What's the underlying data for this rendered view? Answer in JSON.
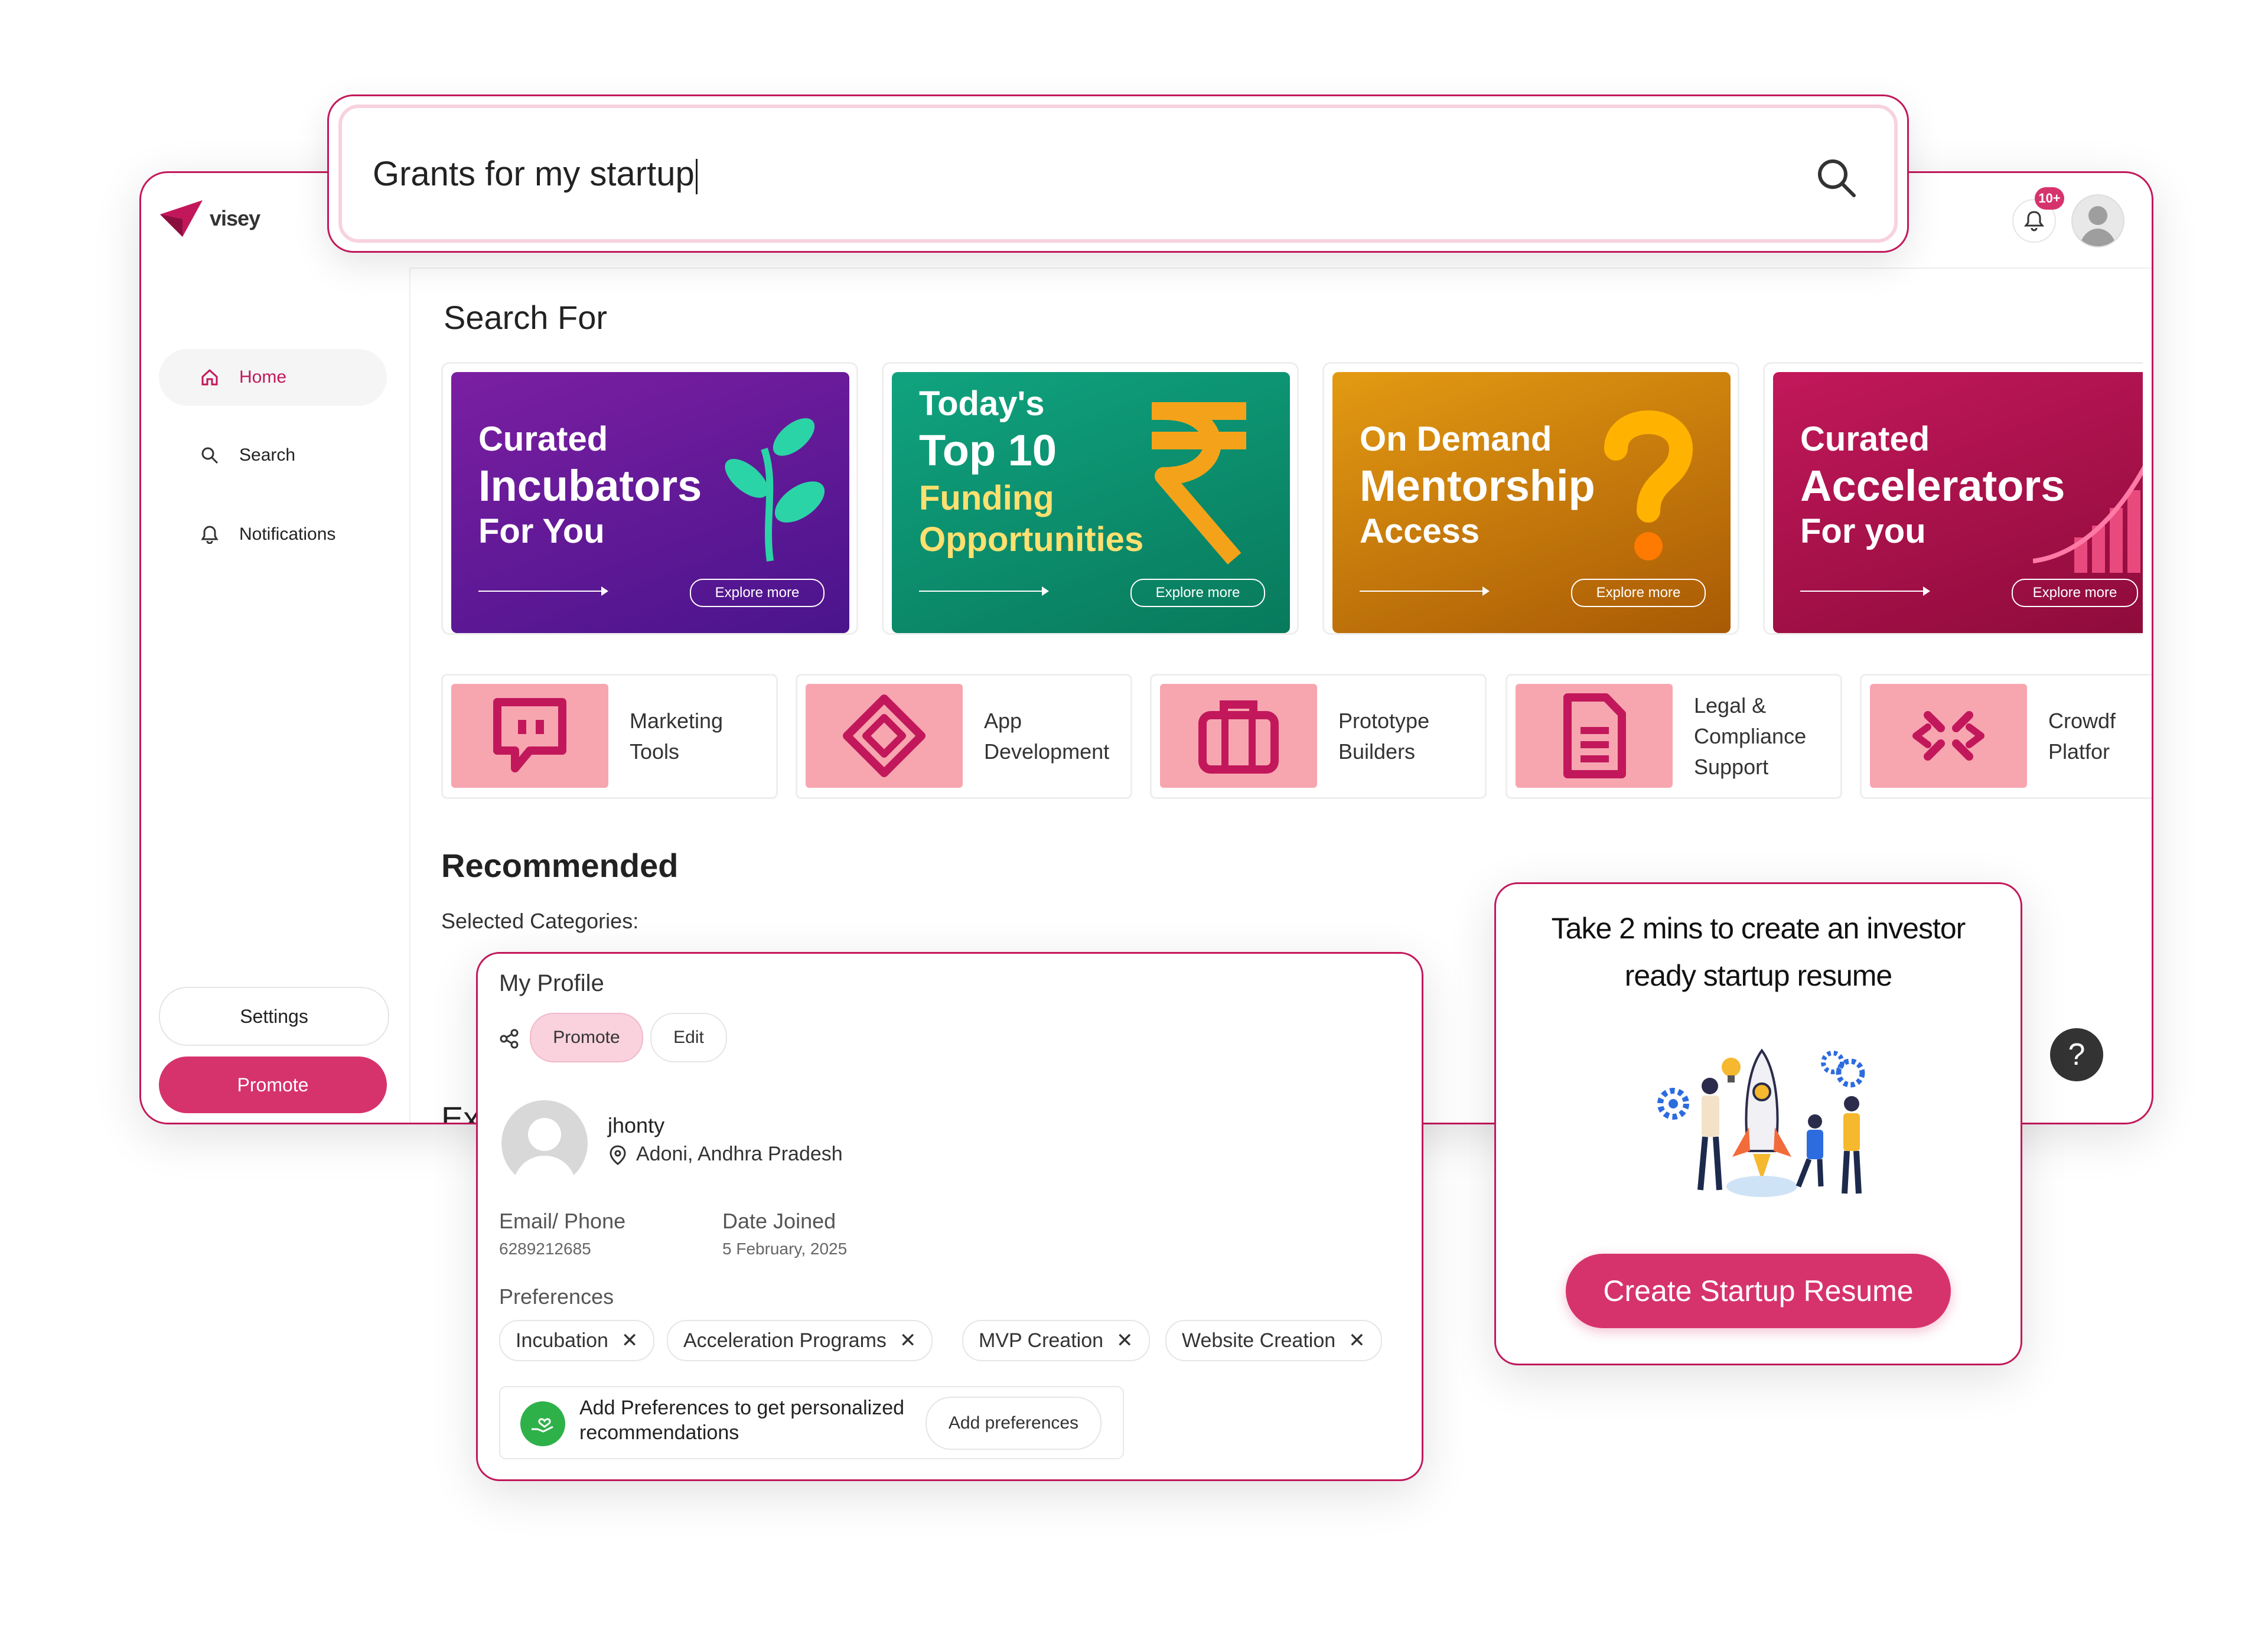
{
  "brand": {
    "name": "visey"
  },
  "search": {
    "value": "Grants for my startup"
  },
  "header": {
    "notification_badge": "10+"
  },
  "sidebar": {
    "items": [
      {
        "label": "Home",
        "icon": "home-icon"
      },
      {
        "label": "Search",
        "icon": "search-icon"
      },
      {
        "label": "Notifications",
        "icon": "bell-icon"
      }
    ],
    "settings_label": "Settings",
    "promote_label": "Promote"
  },
  "main": {
    "search_for_title": "Search For",
    "feature_cards": [
      {
        "line1": "Curated",
        "line2": "Incubators",
        "line3": "For You",
        "cta": "Explore more",
        "color": "#6a1b9a"
      },
      {
        "line1": "Today's",
        "line2": "Top 10",
        "line3": "Funding",
        "line4": "Opportunities",
        "cta": "Explore more",
        "color": "#0e8f6d"
      },
      {
        "line1": "On Demand",
        "line2": "Mentorship",
        "line3": "Access",
        "cta": "Explore more",
        "color": "#d8860b"
      },
      {
        "line1": "Curated",
        "line2": "Accelerators",
        "line3": "For you",
        "cta": "Explore more",
        "color": "#b0124d"
      }
    ],
    "categories": [
      {
        "label": "Marketing Tools",
        "icon": "chat-icon"
      },
      {
        "label": "App Development",
        "icon": "cube-icon"
      },
      {
        "label": "Prototype Builders",
        "icon": "briefcase-icon"
      },
      {
        "label": "Legal & Compliance Support",
        "icon": "document-icon"
      },
      {
        "label": "Crowdf Platfor",
        "icon": "arrows-icon"
      }
    ],
    "recommended_title": "Recommended",
    "selected_categories_label": "Selected Categories:",
    "partial_text": "Ex"
  },
  "profile": {
    "title": "My Profile",
    "promote_label": "Promote",
    "edit_label": "Edit",
    "name": "jhonty",
    "location": "Adoni, Andhra Pradesh",
    "email_label": "Email/ Phone",
    "email_value": "6289212685",
    "date_label": "Date Joined",
    "date_value": "5 February, 2025",
    "preferences_label": "Preferences",
    "preferences": [
      "Incubation",
      "Acceleration Programs",
      "MVP Creation",
      "Website Creation"
    ],
    "add_pref_text": "Add Preferences to get personalized recommendations",
    "add_pref_button": "Add preferences"
  },
  "resume": {
    "line1": "Take 2 mins to create an investor",
    "line2": "ready startup resume",
    "button_label": "Create Startup Resume"
  },
  "help": {
    "label": "?"
  },
  "colors": {
    "accent": "#c2185b",
    "brand_pink": "#d6336c"
  }
}
